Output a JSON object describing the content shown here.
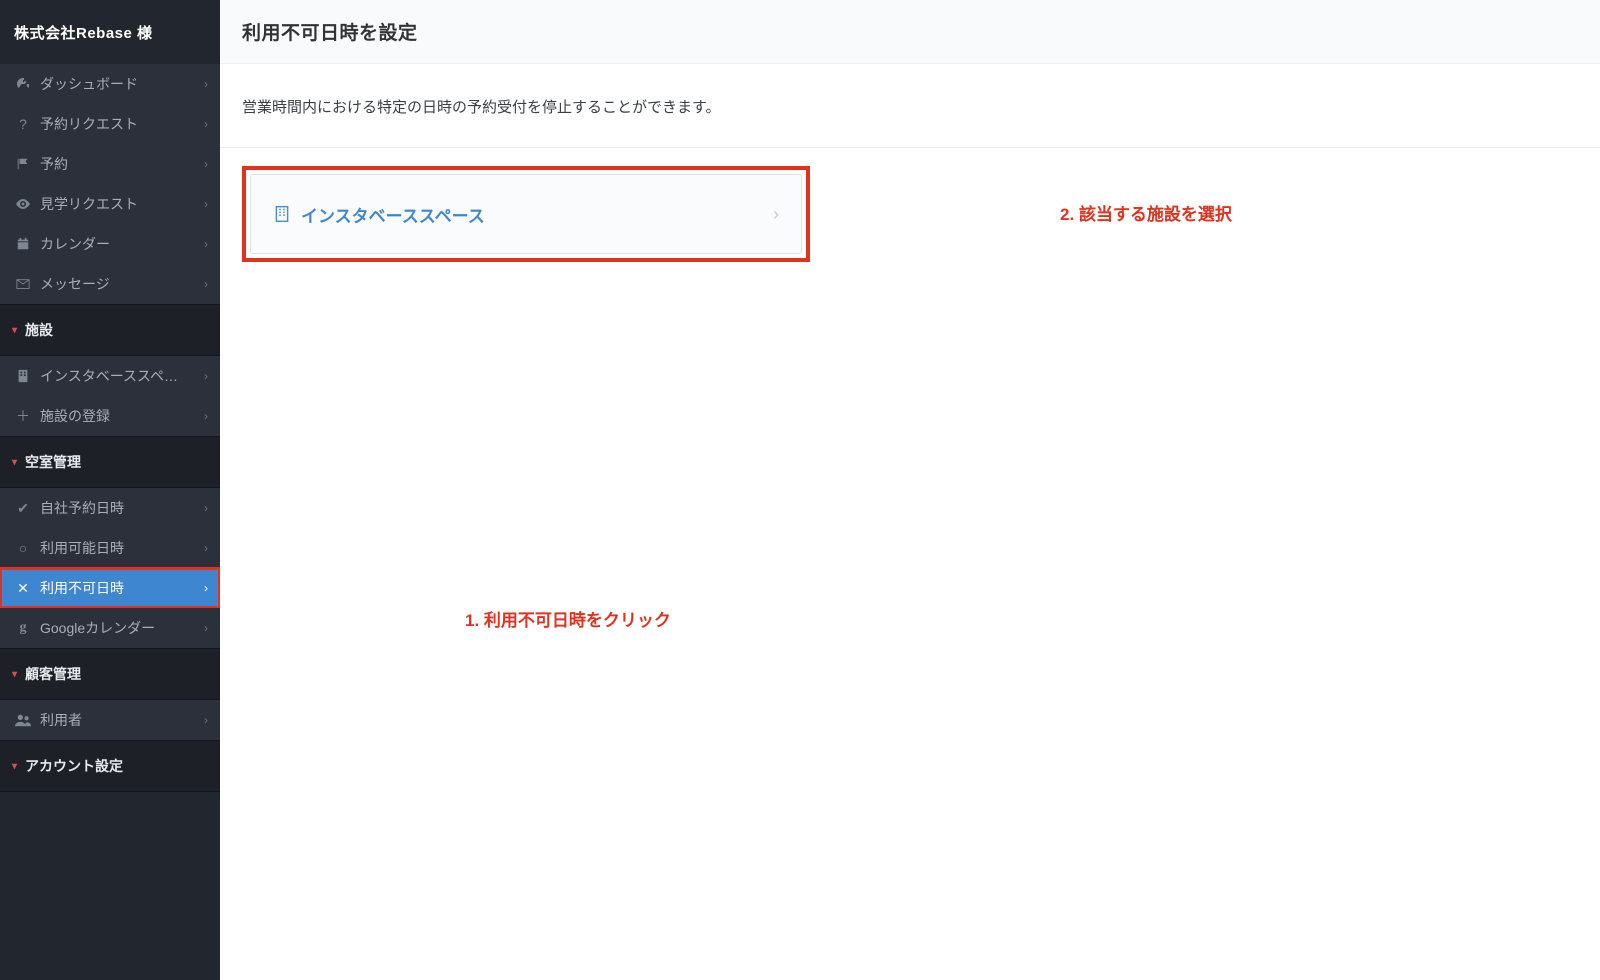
{
  "sidebar": {
    "company": "株式会社Rebase 様",
    "nav1": [
      {
        "icon": "dashboard",
        "label": "ダッシュボード"
      },
      {
        "icon": "question",
        "label": "予約リクエスト"
      },
      {
        "icon": "flag",
        "label": "予約"
      },
      {
        "icon": "eye",
        "label": "見学リクエスト"
      },
      {
        "icon": "calendar",
        "label": "カレンダー"
      },
      {
        "icon": "mail",
        "label": "メッセージ"
      }
    ],
    "sections": [
      {
        "title": "施設",
        "items": [
          {
            "icon": "building",
            "label": "インスタベーススペ…"
          },
          {
            "icon": "plus",
            "label": "施設の登録"
          }
        ]
      },
      {
        "title": "空室管理",
        "items": [
          {
            "icon": "check",
            "label": "自社予約日時"
          },
          {
            "icon": "circle",
            "label": "利用可能日時"
          },
          {
            "icon": "cross",
            "label": "利用不可日時",
            "active": true
          },
          {
            "icon": "g",
            "label": "Googleカレンダー"
          }
        ]
      },
      {
        "title": "顧客管理",
        "items": [
          {
            "icon": "users",
            "label": "利用者"
          }
        ]
      },
      {
        "title": "アカウント設定",
        "items": []
      }
    ]
  },
  "page": {
    "title": "利用不可日時を設定",
    "description": "営業時間内における特定の日時の予約受付を停止することができます。",
    "facility_name": "インスタベーススペース"
  },
  "annotations": {
    "step1": "1. 利用不可日時をクリック",
    "step2": "2.  該当する施設を選択"
  }
}
